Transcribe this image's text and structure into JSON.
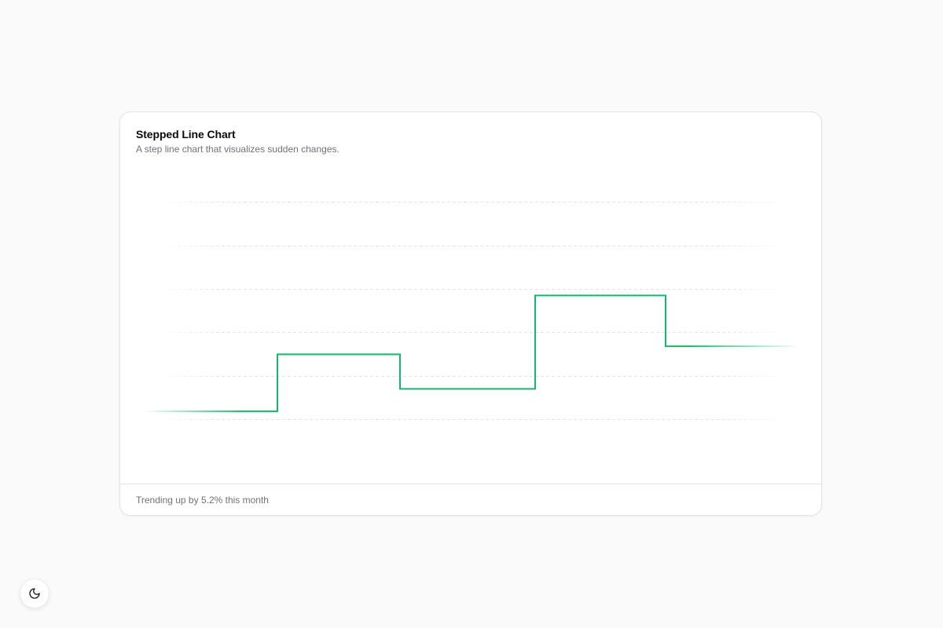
{
  "card": {
    "title": "Stepped Line Chart",
    "subtitle": "A step line chart that visualizes sudden changes.",
    "footer": "Trending up by 5.2% this month"
  },
  "theme_toggle": {
    "icon": "moon-icon"
  },
  "colors": {
    "line": "#10b96b",
    "grid": "#e4e4e7",
    "background": "#fafafa"
  },
  "chart_data": {
    "type": "line",
    "interpolation": "step",
    "x": [
      0,
      1,
      2,
      3,
      4,
      5
    ],
    "values": [
      180,
      320,
      235,
      465,
      340,
      340
    ],
    "ylim": [
      0,
      800
    ],
    "grid": true,
    "grid_style": "dashed-horizontal"
  }
}
